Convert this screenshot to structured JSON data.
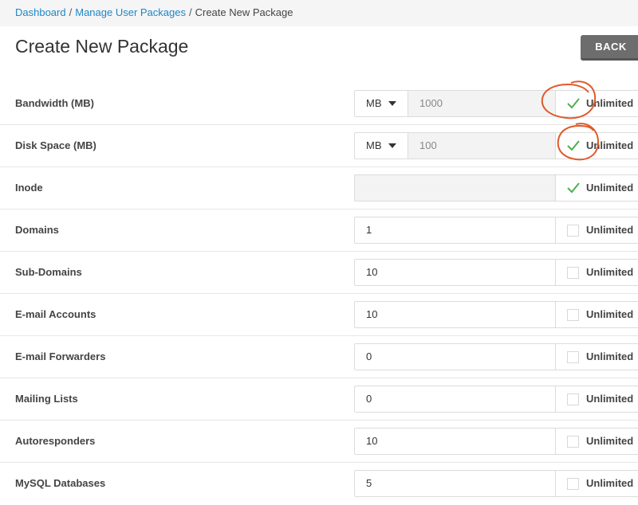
{
  "breadcrumb": {
    "items": [
      "Dashboard",
      "Manage User Packages"
    ],
    "separator": "/",
    "current": "Create New Package"
  },
  "page": {
    "title": "Create New Package",
    "back_label": "BACK"
  },
  "unlimited_label": "Unlimited",
  "rows": [
    {
      "label": "Bandwidth (MB)",
      "unit": "MB",
      "value": "1000",
      "unlimited": true
    },
    {
      "label": "Disk Space (MB)",
      "unit": "MB",
      "value": "100",
      "unlimited": true
    },
    {
      "label": "Inode",
      "value": "",
      "unlimited": true
    },
    {
      "label": "Domains",
      "value": "1",
      "unlimited": false
    },
    {
      "label": "Sub-Domains",
      "value": "10",
      "unlimited": false
    },
    {
      "label": "E-mail Accounts",
      "value": "10",
      "unlimited": false
    },
    {
      "label": "E-mail Forwarders",
      "value": "0",
      "unlimited": false
    },
    {
      "label": "Mailing Lists",
      "value": "0",
      "unlimited": false
    },
    {
      "label": "Autoresponders",
      "value": "10",
      "unlimited": false
    },
    {
      "label": "MySQL Databases",
      "value": "5",
      "unlimited": false
    }
  ],
  "colors": {
    "link": "#1d87c8",
    "check": "#4caf50",
    "annotation": "#e05a2a",
    "back_button": "#6d6d6d"
  }
}
